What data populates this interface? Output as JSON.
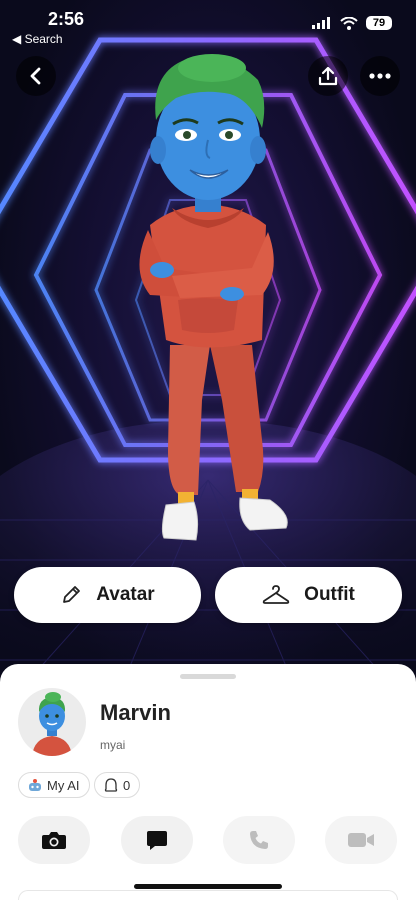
{
  "status": {
    "time": "2:56",
    "back_app": "◀ Search",
    "battery": "79"
  },
  "hero": {
    "back_icon": "chevron-left-icon",
    "share_icon": "share-icon",
    "more_icon": "more-icon"
  },
  "actions": {
    "avatar_label": "Avatar",
    "outfit_label": "Outfit"
  },
  "profile": {
    "name": "Marvin",
    "handle": "myai",
    "chips": [
      {
        "icon": "robot-icon",
        "label": "My AI"
      },
      {
        "icon": "ghost-icon",
        "label": "0"
      }
    ]
  },
  "buttons": [
    {
      "icon": "camera-icon",
      "enabled": true
    },
    {
      "icon": "chat-icon",
      "enabled": true
    },
    {
      "icon": "phone-icon",
      "enabled": false
    },
    {
      "icon": "video-icon",
      "enabled": false
    }
  ],
  "colors": {
    "neon_blue": "#5b7dff",
    "neon_purple": "#c24dff",
    "skin": "#3d8fe0",
    "hair": "#3fa34d",
    "outfit": "#d4533f"
  }
}
